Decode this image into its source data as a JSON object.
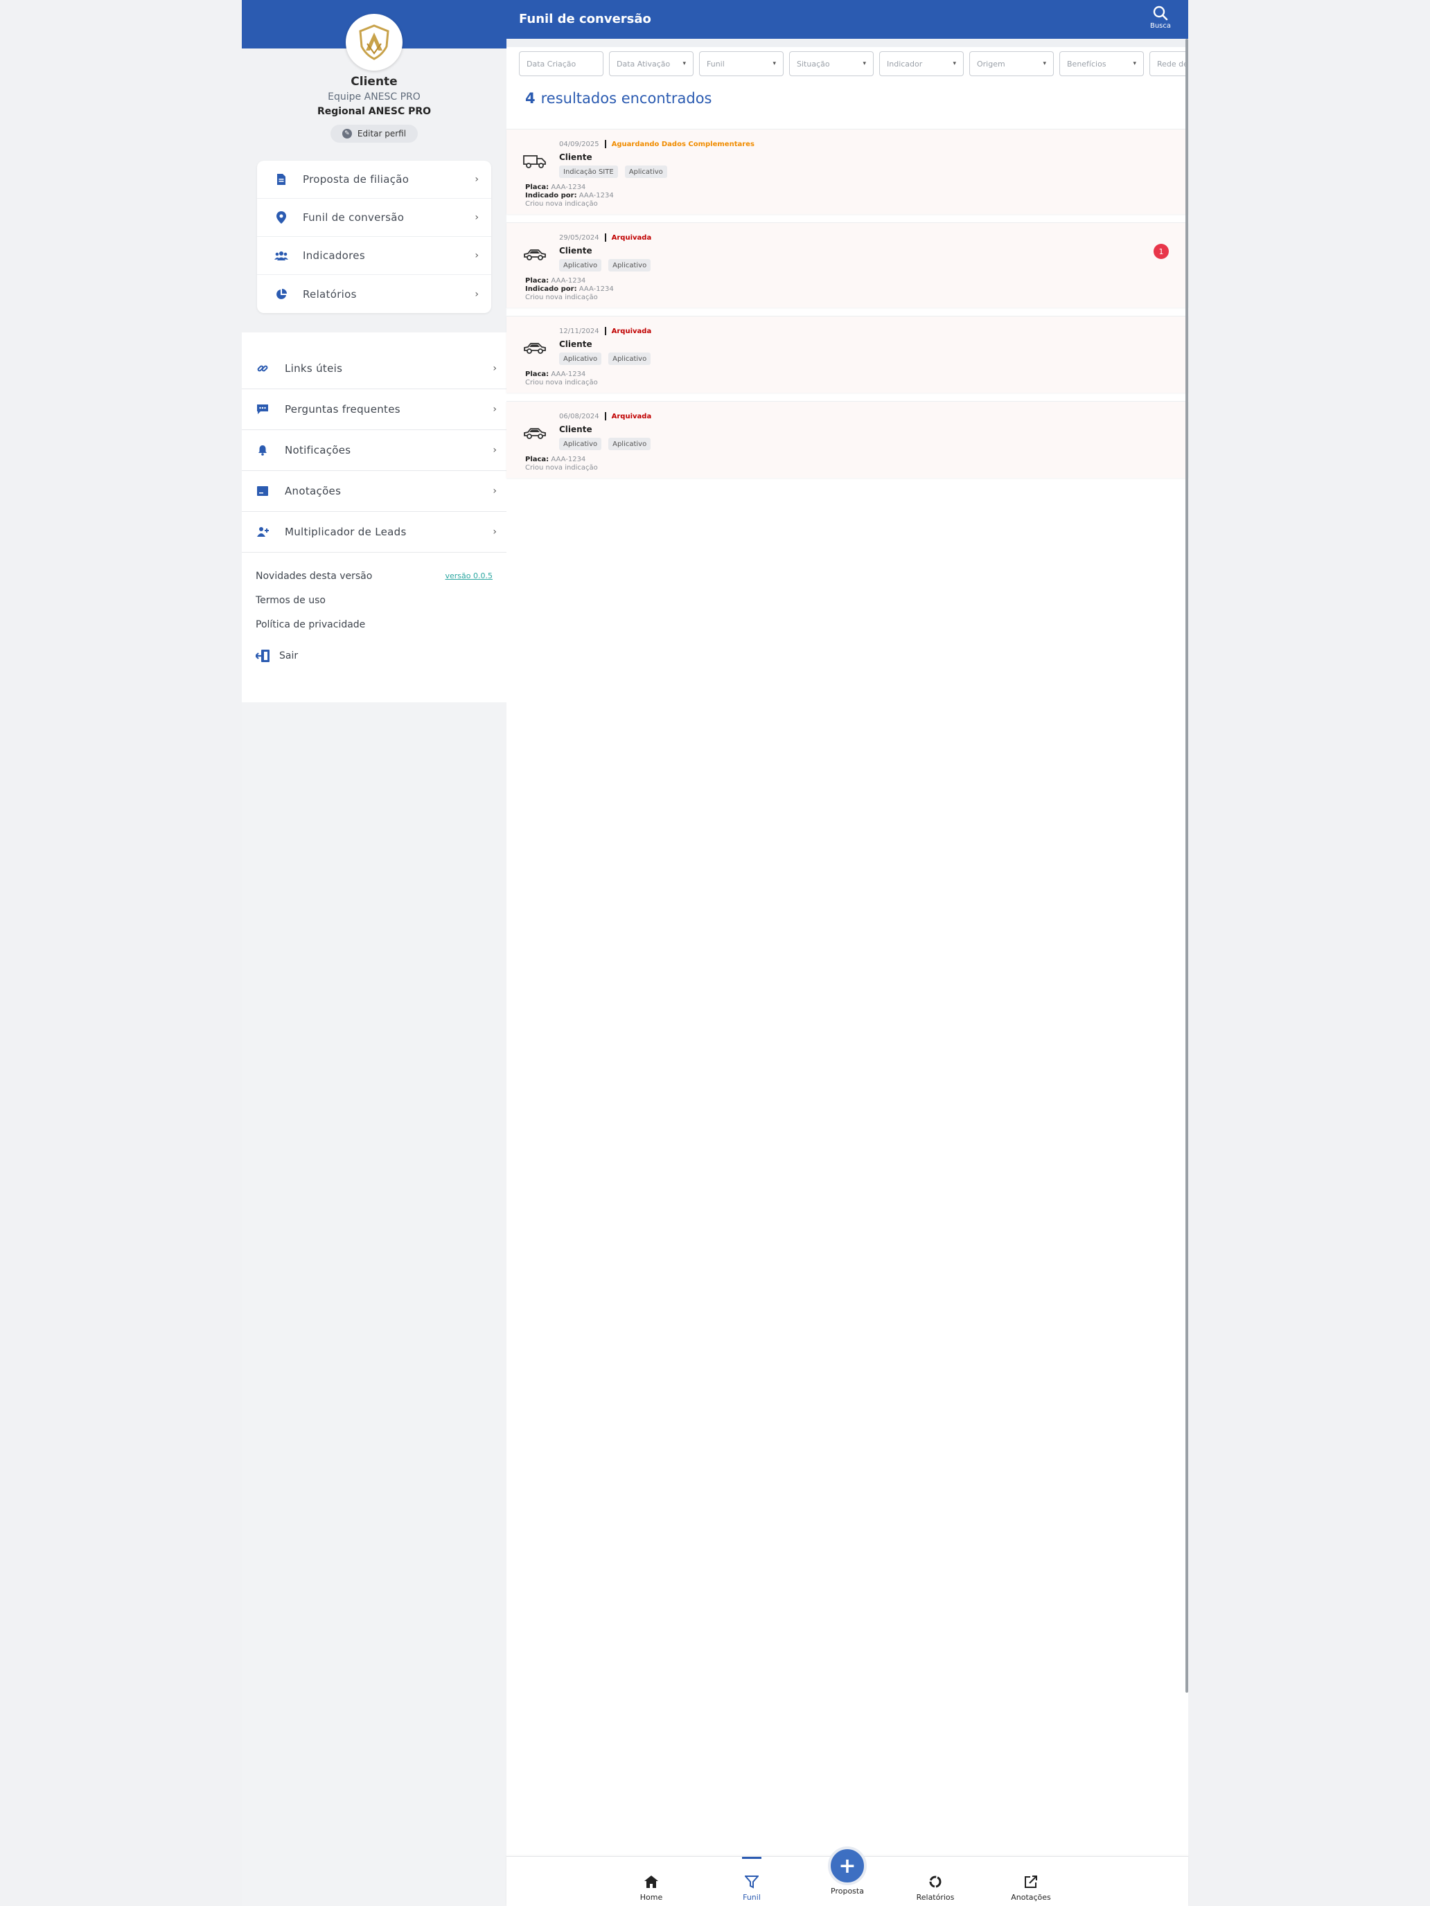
{
  "sidebar": {
    "profile": {
      "name": "Cliente",
      "team": "Equipe ANESC PRO",
      "regional": "Regional ANESC PRO",
      "edit_label": "Editar perfil"
    },
    "card_items": [
      {
        "label": "Proposta de filiação",
        "icon": "document-icon"
      },
      {
        "label": "Funil de conversão",
        "icon": "location-pin-icon"
      },
      {
        "label": "Indicadores",
        "icon": "group-icon"
      },
      {
        "label": "Relatórios",
        "icon": "pie-chart-icon"
      }
    ],
    "list_items": [
      {
        "label": "Links úteis",
        "icon": "link-icon"
      },
      {
        "label": "Perguntas frequentes",
        "icon": "chat-icon"
      },
      {
        "label": "Notificações",
        "icon": "bell-icon"
      },
      {
        "label": "Anotações",
        "icon": "note-icon"
      },
      {
        "label": "Multiplicador de Leads",
        "icon": "leads-icon"
      }
    ],
    "footer": {
      "news": "Novidades desta versão",
      "version": "versão 0.0.5",
      "terms": "Termos de uso",
      "privacy": "Política de privacidade",
      "logout": "Sair"
    }
  },
  "header": {
    "title": "Funil de conversão",
    "search_label": "Busca"
  },
  "filters": [
    "Data Criação",
    "Data Ativação",
    "Funil",
    "Situação",
    "Indicador",
    "Origem",
    "Benefícios",
    "Rede de"
  ],
  "results": {
    "count": "4",
    "label": "resultados encontrados"
  },
  "leads": [
    {
      "date": "04/09/2025",
      "status": "Aguardando Dados Complementares",
      "status_color": "#f08c00",
      "name": "Cliente",
      "tags": [
        "Indicação SITE",
        "Aplicativo"
      ],
      "vehicle": "truck-icon",
      "placa_label": "Placa:",
      "placa": "AAA-1234",
      "indicado_label": "Indicado por:",
      "indicado": "AAA-1234",
      "note": "Criou nova indicação",
      "badge": ""
    },
    {
      "date": "29/05/2024",
      "status": "Arquivada",
      "status_color": "#c00000",
      "name": "Cliente",
      "tags": [
        "Aplicativo",
        "Aplicativo"
      ],
      "vehicle": "car-icon",
      "placa_label": "Placa:",
      "placa": "AAA-1234",
      "indicado_label": "Indicado por:",
      "indicado": "AAA-1234",
      "note": "Criou nova indicação",
      "badge": "1"
    },
    {
      "date": "12/11/2024",
      "status": "Arquivada",
      "status_color": "#c00000",
      "name": "Cliente",
      "tags": [
        "Aplicativo",
        "Aplicativo"
      ],
      "vehicle": "car-icon",
      "placa_label": "Placa:",
      "placa": "AAA-1234",
      "indicado_label": "",
      "indicado": "",
      "note": "Criou nova indicação",
      "badge": ""
    },
    {
      "date": "06/08/2024",
      "status": "Arquivada",
      "status_color": "#c00000",
      "name": "Cliente",
      "tags": [
        "Aplicativo",
        "Aplicativo"
      ],
      "vehicle": "car-icon",
      "placa_label": "Placa:",
      "placa": "AAA-1234",
      "indicado_label": "",
      "indicado": "",
      "note": "Criou nova indicação",
      "badge": ""
    }
  ],
  "bottom_nav": {
    "home": "Home",
    "funil": "Funil",
    "proposta": "Proposta",
    "relatorios": "Relatórios",
    "anotacoes": "Anotações",
    "fab_symbol": "+"
  },
  "colors": {
    "primary": "#2b5bb1",
    "badge": "#e8364a",
    "version_link": "#2aa6a0"
  }
}
